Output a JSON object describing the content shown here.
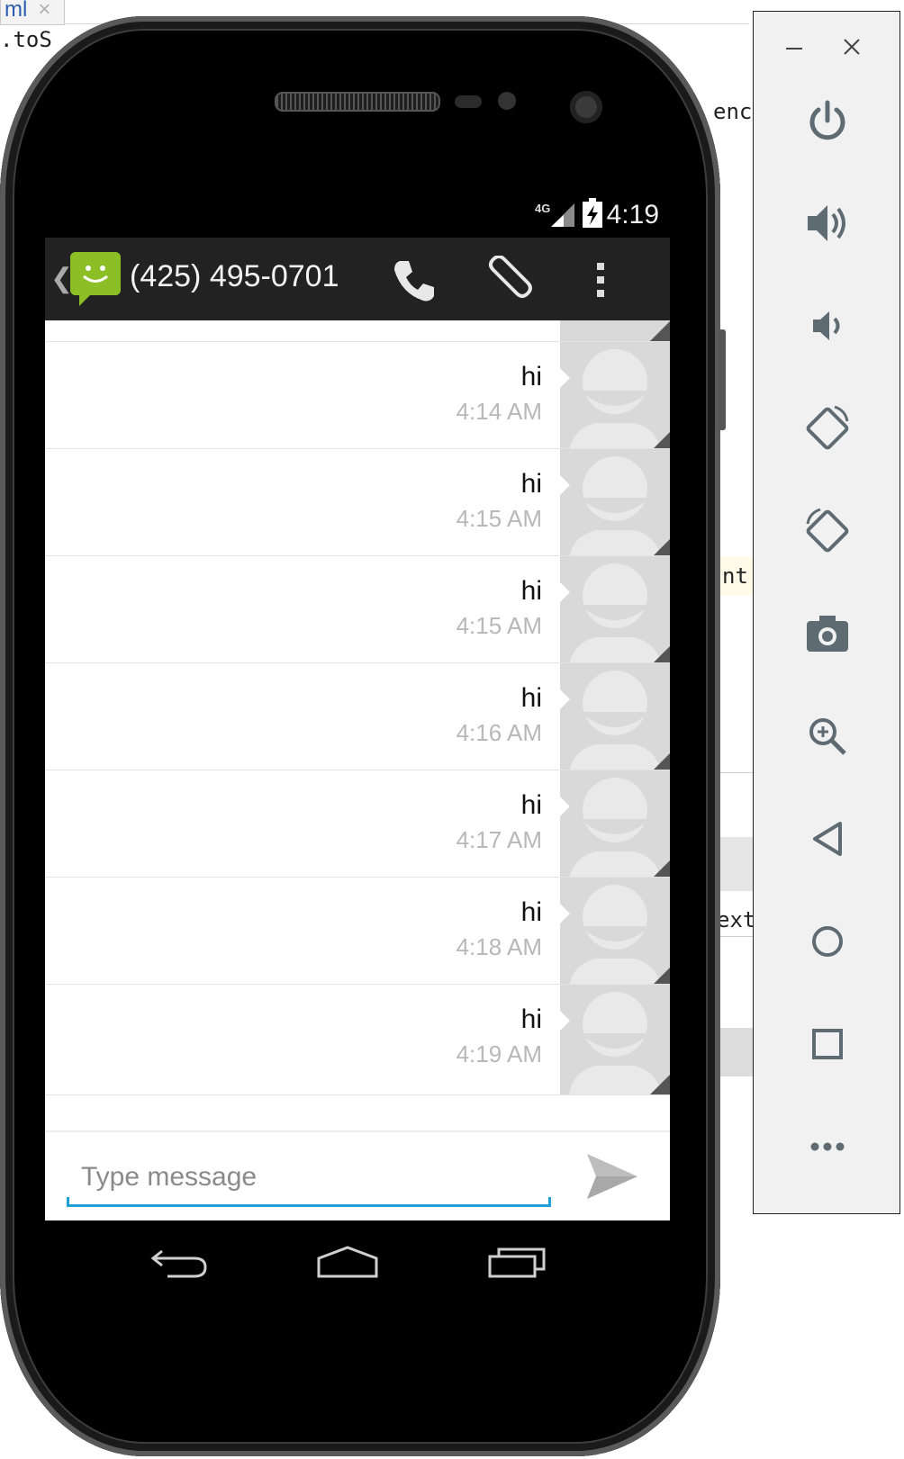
{
  "ide": {
    "tab_label": "ml",
    "tab_close": "×",
    "code_fragments": [
      ".toS",
      "enc",
      "nt",
      "ext"
    ]
  },
  "status_bar": {
    "time": "4:19",
    "network": "4G"
  },
  "action_bar": {
    "contact": "(425) 495-0701"
  },
  "messages": [
    {
      "text": "hi",
      "time": "4:14 AM"
    },
    {
      "text": "hi",
      "time": "4:15 AM"
    },
    {
      "text": "hi",
      "time": "4:15 AM"
    },
    {
      "text": "hi",
      "time": "4:16 AM"
    },
    {
      "text": "hi",
      "time": "4:17 AM"
    },
    {
      "text": "hi",
      "time": "4:18 AM"
    },
    {
      "text": "hi",
      "time": "4:19 AM"
    }
  ],
  "composer": {
    "placeholder": "Type message"
  },
  "emulator_controls": [
    "power-icon",
    "volume-up-icon",
    "volume-down-icon",
    "rotate-left-icon",
    "rotate-right-icon",
    "camera-icon",
    "zoom-icon",
    "back-icon",
    "home-icon",
    "overview-icon",
    "more-icon"
  ],
  "colors": {
    "accent": "#1fa0d8",
    "app_icon": "#8cbf26",
    "action_bar": "#222222"
  }
}
